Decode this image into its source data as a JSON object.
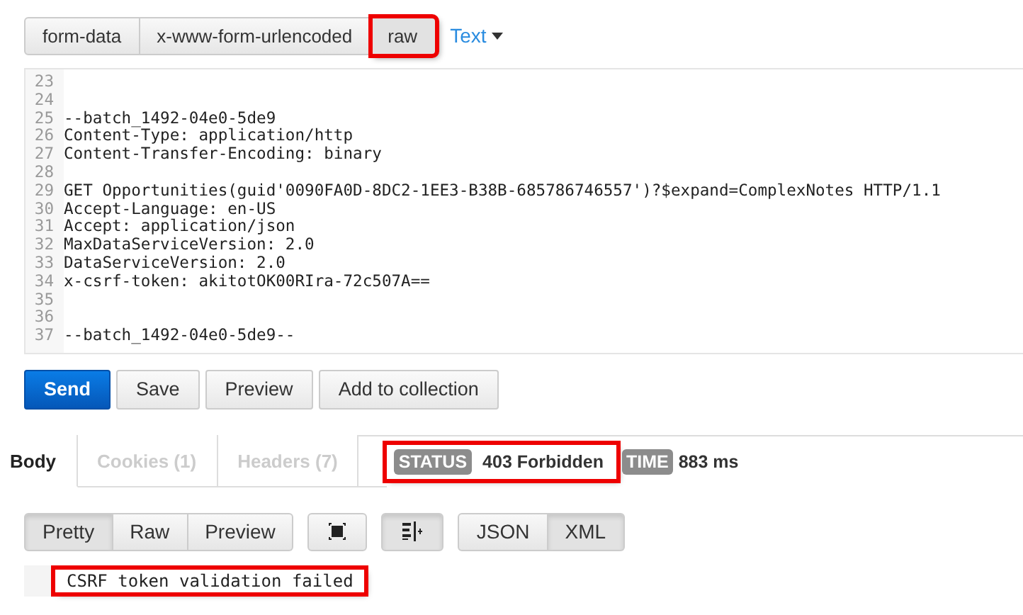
{
  "body_modes": [
    {
      "label": "form-data",
      "selected": false,
      "highlighted": false
    },
    {
      "label": "x-www-form-urlencoded",
      "selected": false,
      "highlighted": false
    },
    {
      "label": "raw",
      "selected": true,
      "highlighted": true
    }
  ],
  "format_dropdown": {
    "label": "Text"
  },
  "editor": {
    "lines": [
      {
        "number": "23"
      },
      {
        "number": "24"
      },
      {
        "number": "25",
        "text": "--batch_1492-04e0-5de9"
      },
      {
        "number": "26",
        "text": "Content-Type: application/http"
      },
      {
        "number": "27",
        "text": "Content-Transfer-Encoding: binary"
      },
      {
        "number": "28"
      },
      {
        "number": "29",
        "text": "GET Opportunities(guid'0090FA0D-8DC2-1EE3-B38B-685786746557')?$expand=ComplexNotes HTTP/1.1"
      },
      {
        "number": "30",
        "text": "Accept-Language: en-US"
      },
      {
        "number": "31",
        "text": "Accept: application/json"
      },
      {
        "number": "32",
        "text": "MaxDataServiceVersion: 2.0"
      },
      {
        "number": "33",
        "text": "DataServiceVersion: 2.0"
      },
      {
        "number": "34",
        "text": "x-csrf-token: akitotOK00RIra-72c507A=="
      },
      {
        "number": "35"
      },
      {
        "number": "36"
      },
      {
        "number": "37",
        "text": "--batch_1492-04e0-5de9--"
      }
    ]
  },
  "actions": [
    {
      "label": "Send",
      "kind": "primary"
    },
    {
      "label": "Save",
      "kind": "default"
    },
    {
      "label": "Preview",
      "kind": "default"
    },
    {
      "label": "Add to collection",
      "kind": "default"
    }
  ],
  "response_tabs": [
    {
      "label": "Body",
      "selected": true
    },
    {
      "label": "Cookies (1)",
      "selected": false
    },
    {
      "label": "Headers (7)",
      "selected": false
    }
  ],
  "status": {
    "label": "STATUS",
    "value": "403 Forbidden",
    "highlighted": true
  },
  "time": {
    "label": "TIME",
    "value": "883 ms"
  },
  "view_modes": [
    {
      "label": "Pretty",
      "selected": true
    },
    {
      "label": "Raw",
      "selected": false
    },
    {
      "label": "Preview",
      "selected": false
    }
  ],
  "formats": [
    {
      "label": "JSON",
      "selected": false
    },
    {
      "label": "XML",
      "selected": true
    }
  ],
  "result": {
    "lines": [
      {
        "text": "CSRF token validation failed",
        "highlighted": true
      }
    ]
  }
}
